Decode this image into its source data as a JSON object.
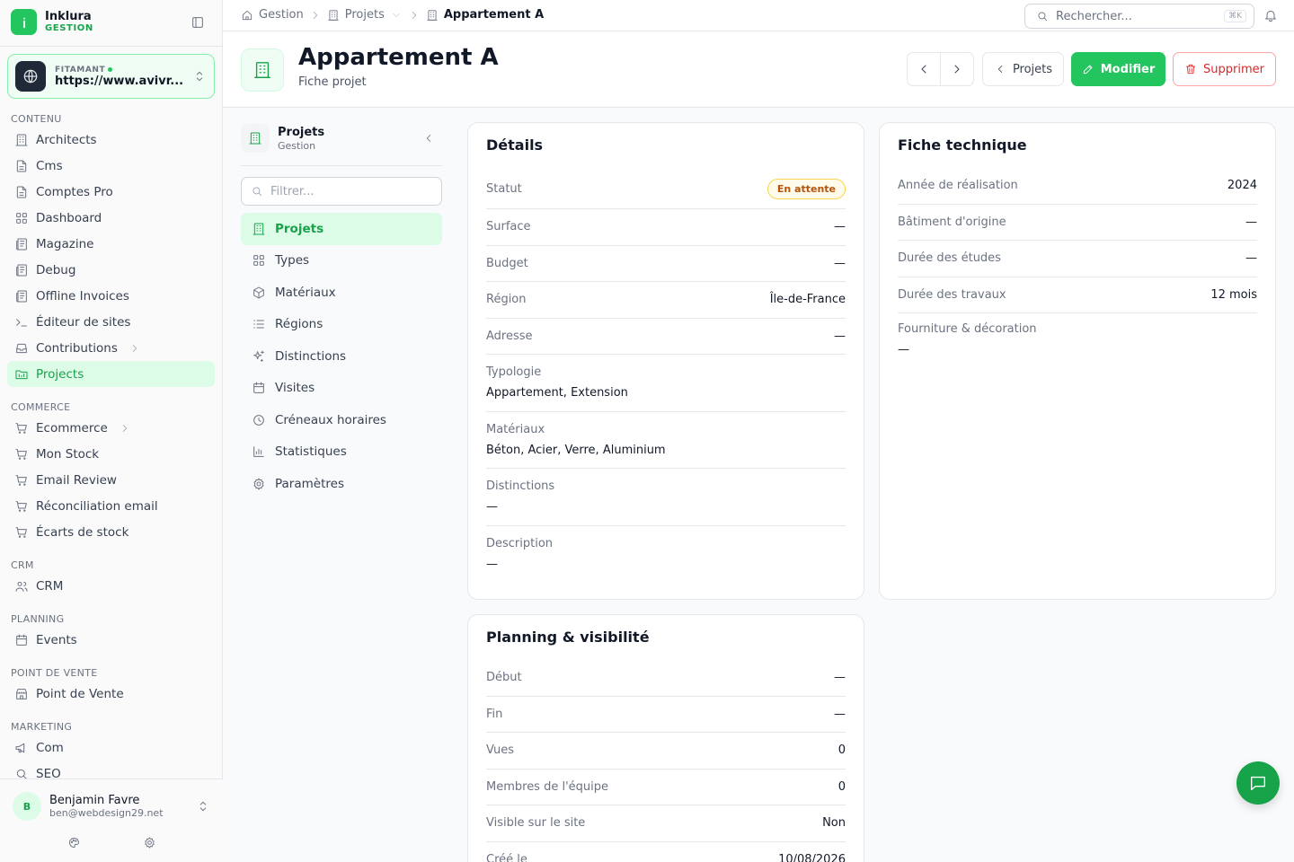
{
  "brand": {
    "name": "Inklura",
    "sub": "GESTION"
  },
  "workspace": {
    "label": "FITAMANT",
    "url": "https://www.avivr..."
  },
  "nav": {
    "sections": [
      {
        "title": "CONTENU",
        "items": [
          {
            "label": "Architects",
            "icon": "building-icon"
          },
          {
            "label": "Cms",
            "icon": "file-icon"
          },
          {
            "label": "Comptes Pro",
            "icon": "file-icon"
          },
          {
            "label": "Dashboard",
            "icon": "grid-icon"
          },
          {
            "label": "Magazine",
            "icon": "newspaper-icon"
          },
          {
            "label": "Debug",
            "icon": "newspaper-icon"
          },
          {
            "label": "Offline Invoices",
            "icon": "newspaper-icon"
          },
          {
            "label": "Éditeur de sites",
            "icon": "terminal-icon"
          },
          {
            "label": "Contributions",
            "icon": "inbox-icon"
          },
          {
            "label": "Projects",
            "icon": "folder-icon"
          }
        ]
      },
      {
        "title": "COMMERCE",
        "items": [
          {
            "label": "Ecommerce",
            "icon": "cart-icon"
          },
          {
            "label": "Mon Stock",
            "icon": "cart-icon"
          },
          {
            "label": "Email Review",
            "icon": "cart-icon"
          },
          {
            "label": "Réconciliation email",
            "icon": "cart-icon"
          },
          {
            "label": "Écarts de stock",
            "icon": "cart-icon"
          }
        ]
      },
      {
        "title": "CRM",
        "items": [
          {
            "label": "CRM",
            "icon": "users-icon"
          }
        ]
      },
      {
        "title": "PLANNING",
        "items": [
          {
            "label": "Events",
            "icon": "calendar-icon"
          }
        ]
      },
      {
        "title": "POINT DE VENTE",
        "items": [
          {
            "label": "Point de Vente",
            "icon": "store-icon"
          }
        ]
      },
      {
        "title": "MARKETING",
        "items": [
          {
            "label": "Com",
            "icon": "megaphone-icon"
          },
          {
            "label": "SEO",
            "icon": "search-icon"
          }
        ]
      }
    ]
  },
  "user": {
    "initial": "B",
    "name": "Benjamin Favre",
    "email": "ben@webdesign29.net"
  },
  "breadcrumb": {
    "home": "Gestion",
    "section": "Projets",
    "current": "Appartement A"
  },
  "search": {
    "placeholder": "Rechercher...",
    "shortcut": "⌘K"
  },
  "page": {
    "title": "Appartement A",
    "subtitle": "Fiche projet"
  },
  "actions": {
    "back": "Projets",
    "edit": "Modifier",
    "delete": "Supprimer"
  },
  "subnav": {
    "title": "Projets",
    "subtitle": "Gestion",
    "filter_placeholder": "Filtrer...",
    "items": [
      {
        "label": "Projets",
        "icon": "building-icon"
      },
      {
        "label": "Types",
        "icon": "grid-icon"
      },
      {
        "label": "Matériaux",
        "icon": "box-icon"
      },
      {
        "label": "Régions",
        "icon": "list-icon"
      },
      {
        "label": "Distinctions",
        "icon": "sparkles-icon"
      },
      {
        "label": "Visites",
        "icon": "calendar-icon"
      },
      {
        "label": "Créneaux horaires",
        "icon": "clock-icon"
      },
      {
        "label": "Statistiques",
        "icon": "bar-chart-icon"
      },
      {
        "label": "Paramètres",
        "icon": "gear-icon"
      }
    ]
  },
  "details": {
    "title": "Détails",
    "status_label": "Statut",
    "status_value": "En attente",
    "surface_label": "Surface",
    "surface_value": "—",
    "budget_label": "Budget",
    "budget_value": "—",
    "region_label": "Région",
    "region_value": "Île-de-France",
    "address_label": "Adresse",
    "address_value": "—",
    "typology_label": "Typologie",
    "typology_value": "Appartement, Extension",
    "materials_label": "Matériaux",
    "materials_value": "Béton, Acier, Verre, Aluminium",
    "distinctions_label": "Distinctions",
    "distinctions_value": "—",
    "description_label": "Description",
    "description_value": "—"
  },
  "tech": {
    "title": "Fiche technique",
    "year_label": "Année de réalisation",
    "year_value": "2024",
    "origin_label": "Bâtiment d'origine",
    "origin_value": "—",
    "studies_label": "Durée des études",
    "studies_value": "—",
    "works_label": "Durée des travaux",
    "works_value": "12 mois",
    "supply_label": "Fourniture & décoration",
    "supply_value": "—"
  },
  "planning": {
    "title": "Planning & visibilité",
    "start_label": "Début",
    "start_value": "—",
    "end_label": "Fin",
    "end_value": "—",
    "views_label": "Vues",
    "views_value": "0",
    "team_label": "Membres de l'équipe",
    "team_value": "0",
    "visible_label": "Visible sur le site",
    "visible_value": "Non",
    "created_label": "Créé le",
    "created_value": "10/08/2026"
  },
  "colors": {
    "accent": "#22c55e",
    "accent_dark": "#16a34a",
    "danger": "#dc2626",
    "warning": "#b45309"
  }
}
